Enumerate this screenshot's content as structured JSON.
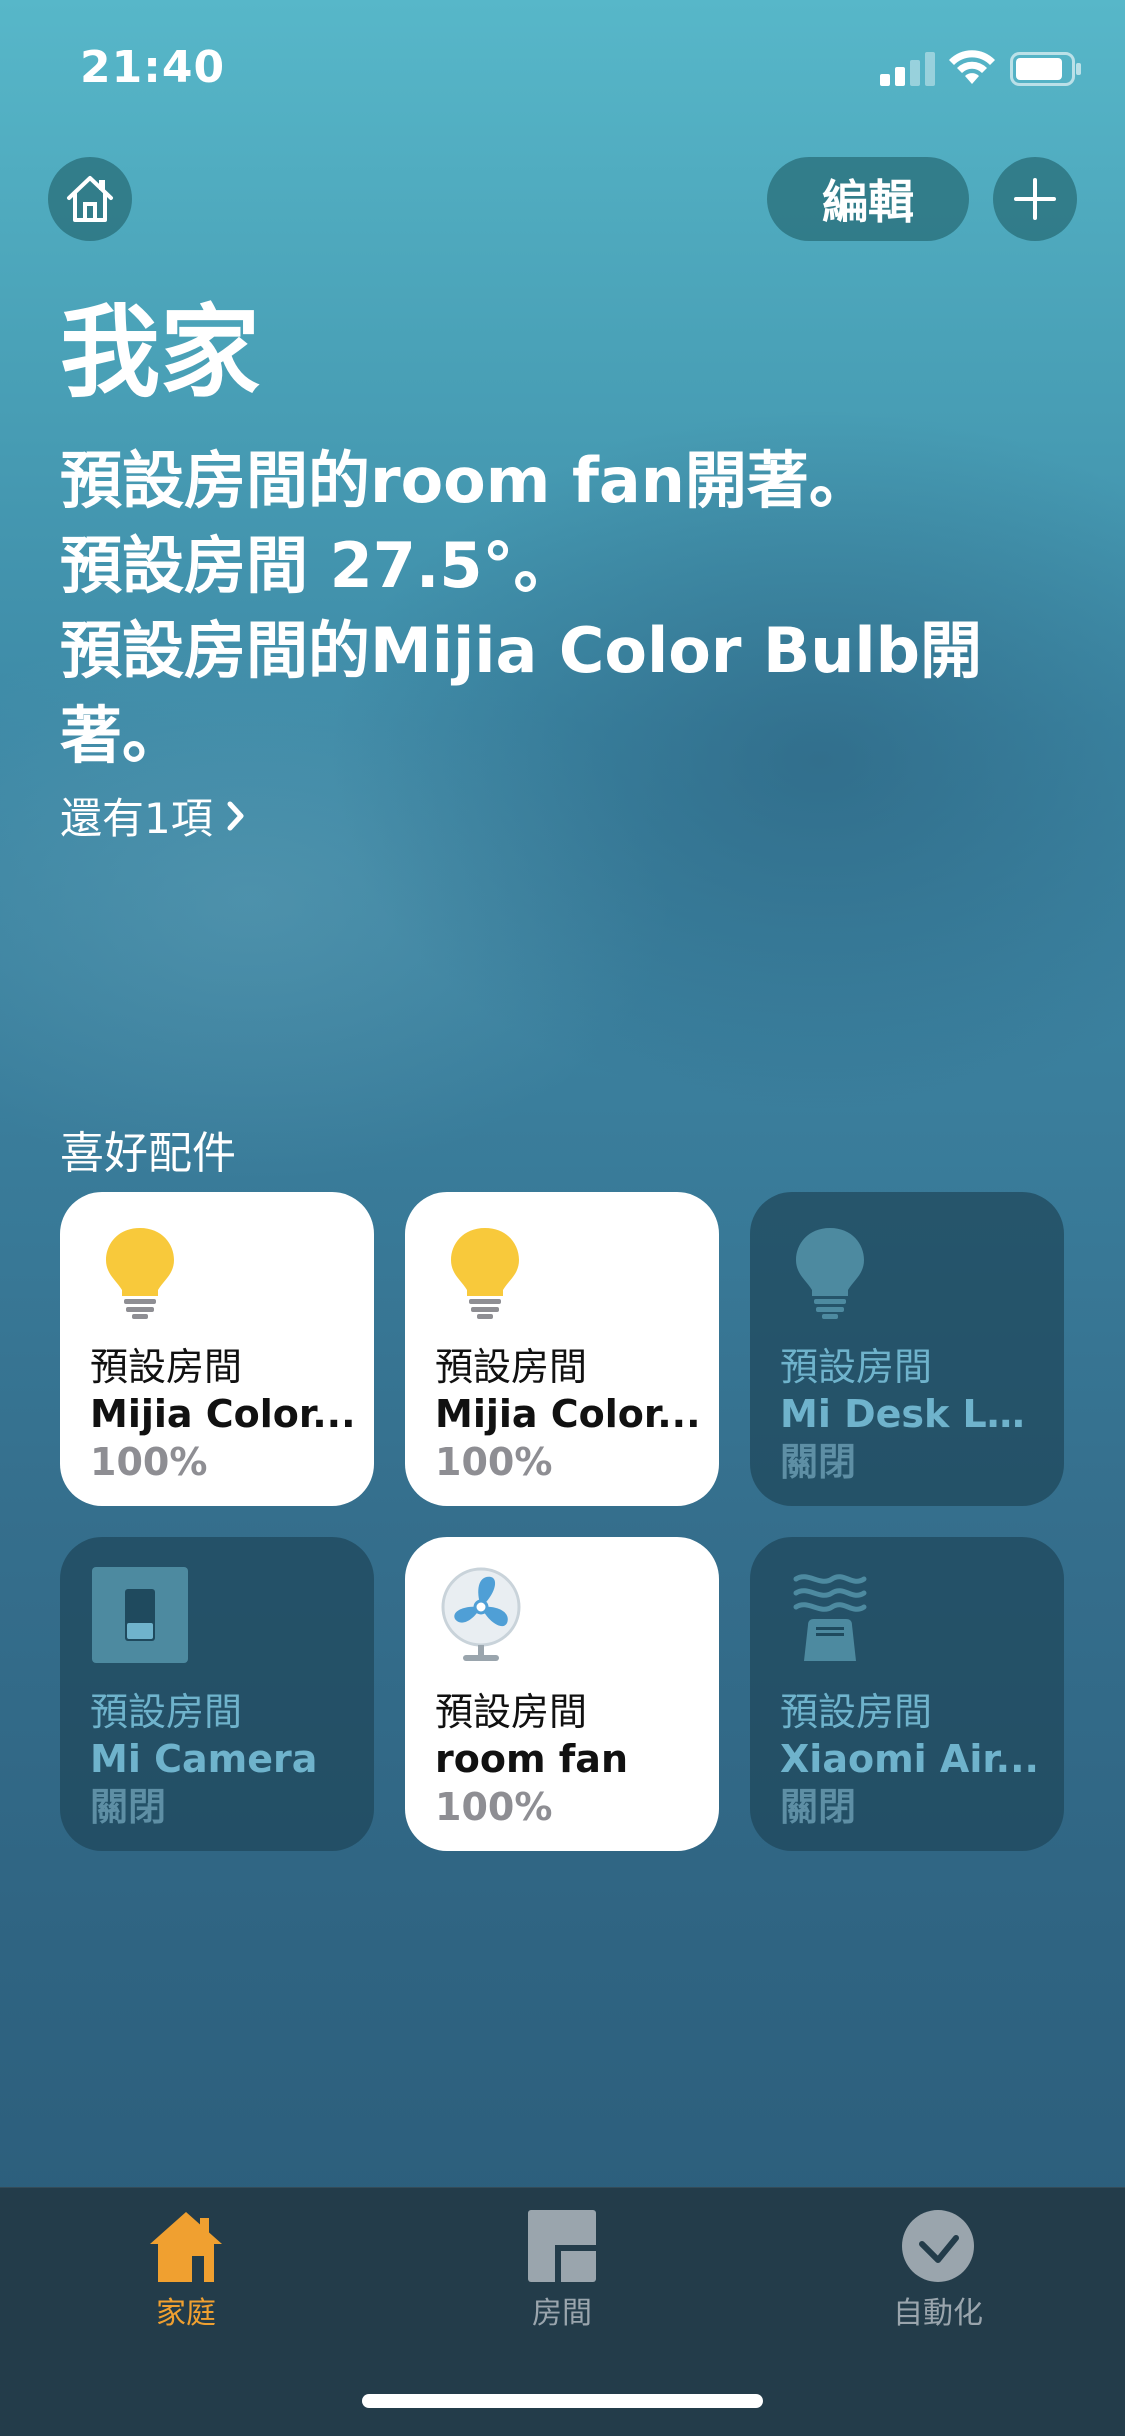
{
  "status_bar": {
    "time": "21:40"
  },
  "header": {
    "edit_label": "編輯"
  },
  "home_name": "我家",
  "summary": [
    "預設房間的room fan開著。",
    "預設房間 27.5°。",
    "預設房間的Mijia Color Bulb開著。"
  ],
  "more_link": "還有1項",
  "favorites": {
    "title": "喜好配件",
    "tiles": [
      {
        "room": "預設房間",
        "name": "Mijia Color...",
        "state": "100%",
        "on": true,
        "icon": "lightbulb-icon"
      },
      {
        "room": "預設房間",
        "name": "Mijia Color...",
        "state": "100%",
        "on": true,
        "icon": "lightbulb-icon"
      },
      {
        "room": "預設房間",
        "name": "Mi Desk La...",
        "state": "關閉",
        "on": false,
        "icon": "lightbulb-icon"
      },
      {
        "room": "預設房間",
        "name": "Mi Camera",
        "state": "關閉",
        "on": false,
        "icon": "switch-icon"
      },
      {
        "room": "預設房間",
        "name": "room fan",
        "state": "100%",
        "on": true,
        "icon": "fan-icon"
      },
      {
        "room": "預設房間",
        "name": "Xiaomi Air...",
        "state": "關閉",
        "on": false,
        "icon": "air-purifier-icon"
      }
    ]
  },
  "tab_bar": {
    "tabs": [
      {
        "label": "家庭",
        "icon": "house-icon",
        "active": true
      },
      {
        "label": "房間",
        "icon": "rooms-icon",
        "active": false
      },
      {
        "label": "自動化",
        "icon": "automation-icon",
        "active": false
      }
    ]
  },
  "colors": {
    "accent_orange": "#f0a030",
    "bulb_yellow": "#f8c93b",
    "tab_inactive": "#9aa5ad",
    "tile_off_text": "#6fb3cc"
  }
}
